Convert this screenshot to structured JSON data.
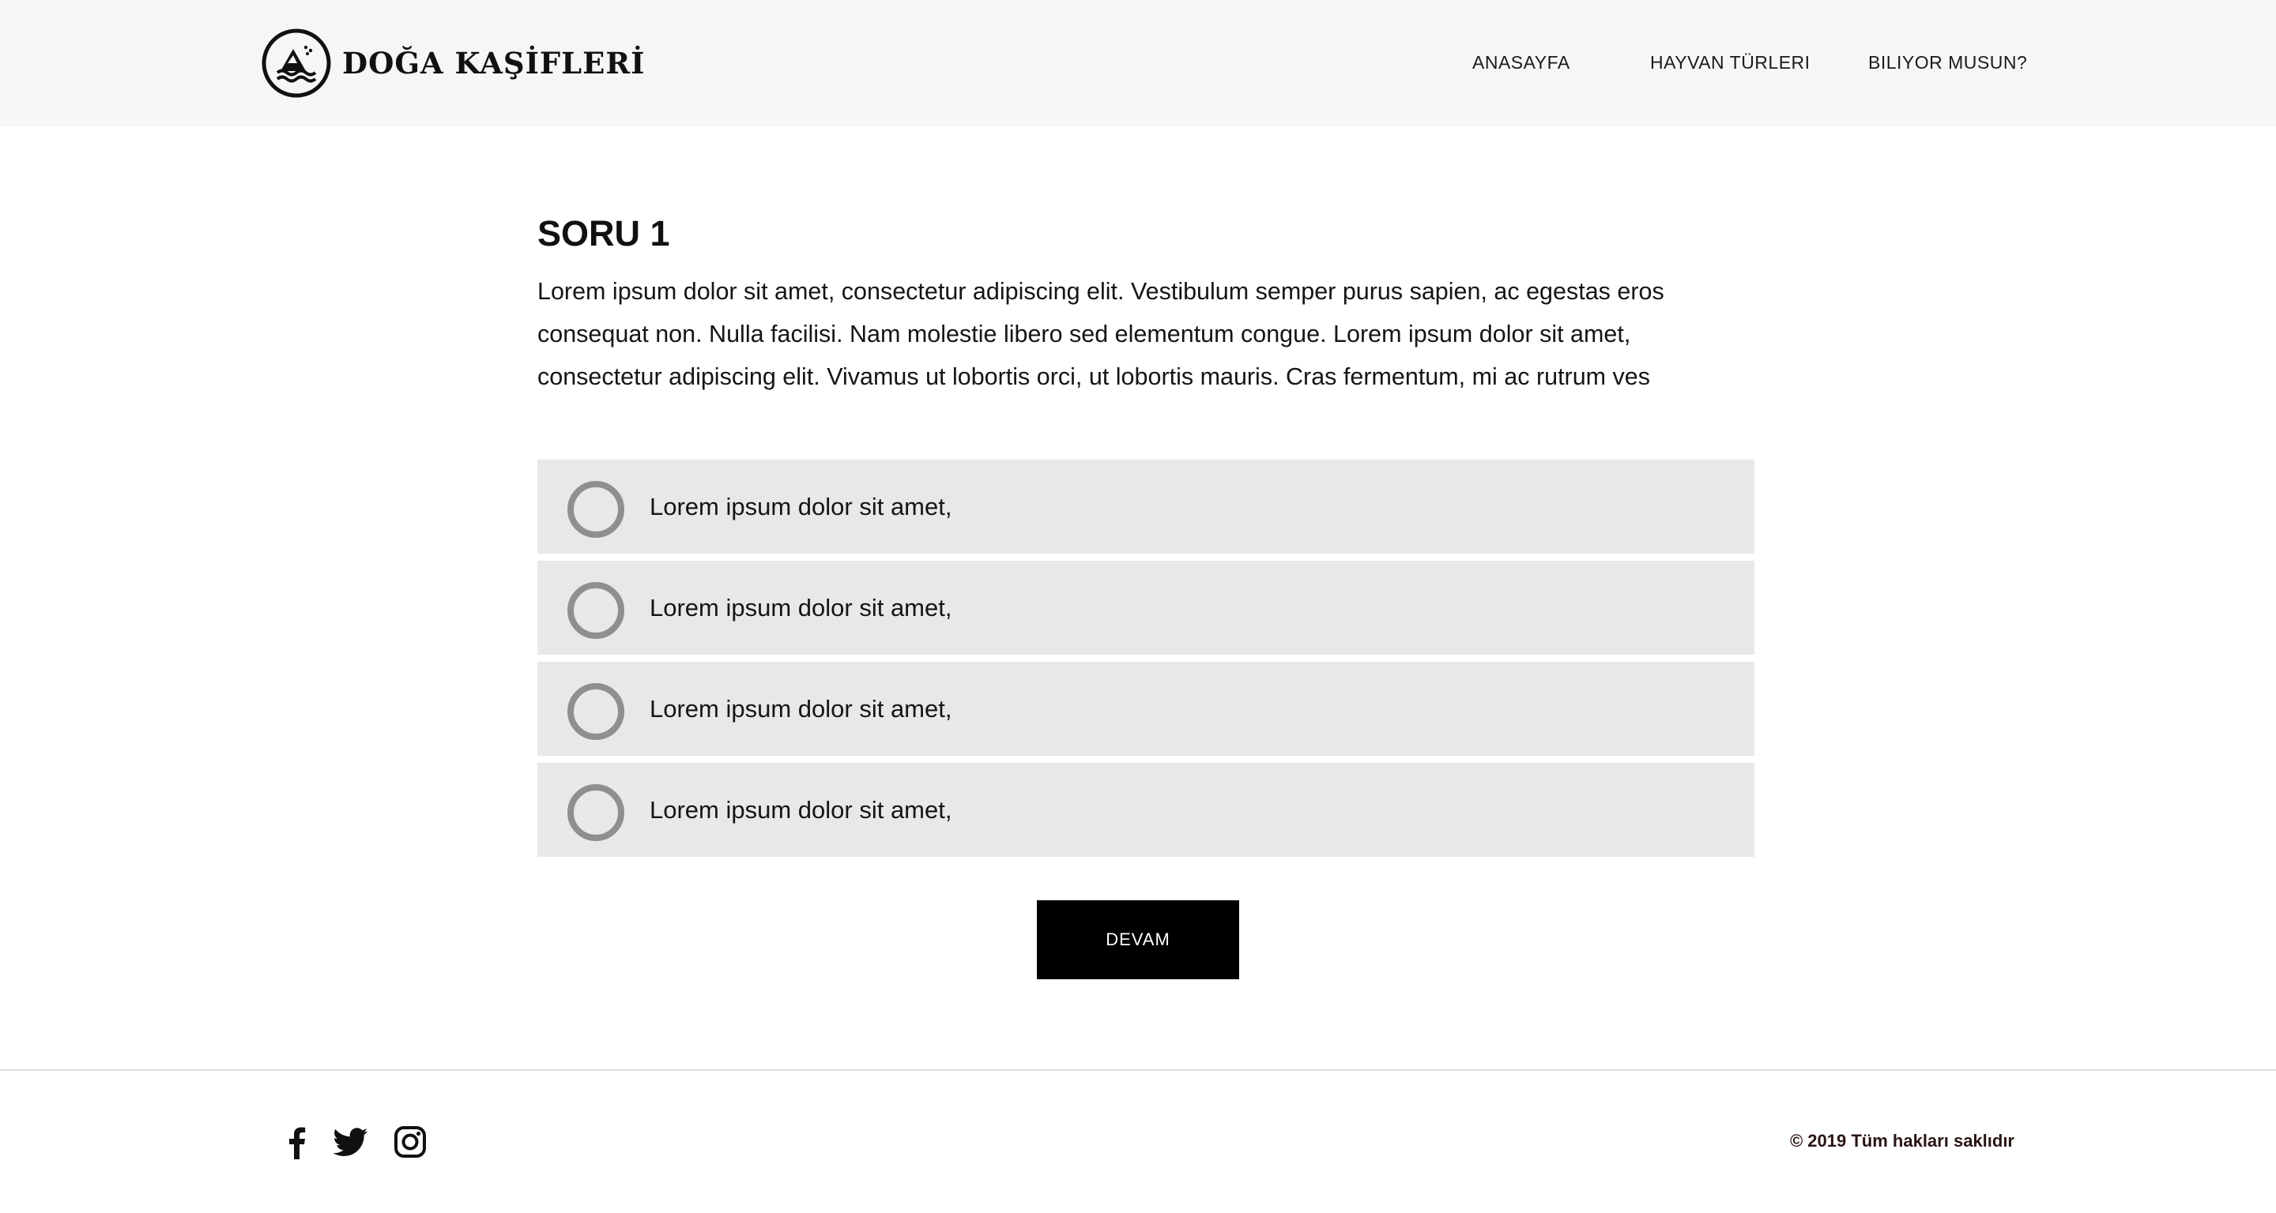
{
  "header": {
    "brand": "DOĞA KAŞİFLERİ",
    "logo_icon": "mountain-waves-logo",
    "nav": [
      {
        "label": "ANASAYFA"
      },
      {
        "label": "HAYVAN TÜRLERI"
      },
      {
        "label": "BILIYOR MUSUN?"
      }
    ]
  },
  "question": {
    "title": "SORU 1",
    "body": "Lorem ipsum dolor sit amet, consectetur adipiscing elit. Vestibulum semper purus sapien, ac egestas eros consequat non. Nulla facilisi. Nam molestie libero sed elementum congue. Lorem ipsum dolor sit amet, consectetur adipiscing elit. Vivamus ut lobortis orci, ut lobortis mauris. Cras fermentum, mi ac rutrum ves",
    "options": [
      {
        "label": "Lorem ipsum dolor sit amet,",
        "selected": false
      },
      {
        "label": "Lorem ipsum dolor sit amet,",
        "selected": false
      },
      {
        "label": "Lorem ipsum dolor sit amet,",
        "selected": false
      },
      {
        "label": "Lorem ipsum dolor sit amet,",
        "selected": false
      }
    ],
    "continue_label": "DEVAM"
  },
  "footer": {
    "social": [
      "facebook-icon",
      "twitter-icon",
      "instagram-icon"
    ],
    "copyright": "©  2019 Tüm hakları saklıdır"
  },
  "colors": {
    "header_bg": "#f6f6f6",
    "option_bg": "#e8e8e8",
    "radio_border": "#8f8f8f",
    "button_bg": "#000000",
    "button_text": "#ffffff"
  }
}
